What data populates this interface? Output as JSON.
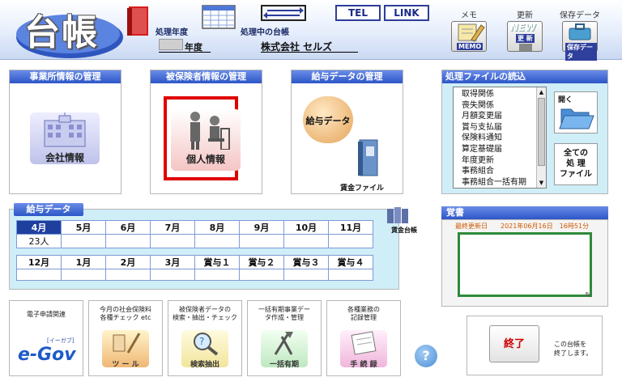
{
  "header": {
    "logo": "台帳",
    "fiscal_year_label": "処理年度",
    "fiscal_year_value": "",
    "fiscal_year_suffix": "年度",
    "current_ledger_label": "処理中の台帳",
    "company_name": "株式会社 セルズ",
    "tel_label": "TEL",
    "link_label": "LINK",
    "memo_caption": "メモ",
    "memo_tag": "MEMO",
    "update_caption": "更新",
    "update_tag": "更 新",
    "update_badge": "NEW",
    "save_caption": "保存データ",
    "save_tag": "保存データ"
  },
  "company_panel": {
    "title": "事業所情報の管理",
    "button_label": "会社情報"
  },
  "insured_panel": {
    "title": "被保険者情報の管理",
    "button_label": "個人情報"
  },
  "salary_panel": {
    "title": "給与データの管理",
    "button_label": "給与データ",
    "file_label": "賃金ファイル"
  },
  "reader_panel": {
    "title": "処理ファイルの読込",
    "items": [
      "取得関係",
      "喪失関係",
      "月額変更届",
      "賞与支払届",
      "保険料通知",
      "算定基礎届",
      "年度更新",
      "事務組合",
      "事務組合一括有期"
    ],
    "open_label": "開く",
    "all_line1": "全ての",
    "all_line2": "処 理",
    "all_line3": "ファイル"
  },
  "salary_grid": {
    "title": "給与データ",
    "row1_headers": [
      "4月",
      "5月",
      "6月",
      "7月",
      "8月",
      "9月",
      "10月",
      "11月"
    ],
    "row1_values": [
      "23人",
      "",
      "",
      "",
      "",
      "",
      "",
      ""
    ],
    "row2_headers": [
      "12月",
      "1月",
      "2月",
      "3月",
      "賞与１",
      "賞与２",
      "賞与３",
      "賞与４"
    ],
    "ledger_label": "賃金台帳"
  },
  "memo": {
    "title": "覚書",
    "last_update": "最終更新日　　2021年06月16日　16時51分"
  },
  "tiles": {
    "egov_caption": "電子申請関連",
    "egov_label": "e-Gov",
    "egov_sub": "[イーガブ]",
    "check_caption_1": "今月の社会保険料",
    "check_caption_2": "各種チェック etc",
    "check_label": "ツ ー ル",
    "search_caption_1": "被保険者データの",
    "search_caption_2": "検索・抽出・チェック",
    "search_label": "検索抽出",
    "bulk_caption_1": "一括有期事業デー",
    "bulk_caption_2": "タ作成・管理",
    "bulk_label": "一括有期",
    "record_caption_1": "各種業務の",
    "record_caption_2": "記録管理",
    "record_label": "手 続 録"
  },
  "help_label": "?",
  "exit": {
    "button_label": "終了",
    "desc_1": "この台帳を",
    "desc_2": "終了します。"
  },
  "colors": {
    "section_blue": "#2d56c7",
    "highlight_red": "#e00000",
    "memo_green": "#2f8a3a",
    "grid_bg": "#cfeef7"
  }
}
